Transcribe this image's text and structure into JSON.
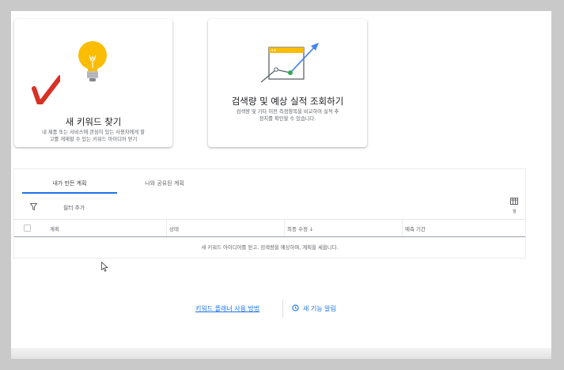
{
  "cards": [
    {
      "title": "새 키워드 찾기",
      "description_line1": "내 제품 또는 서비스에 관심이 있는 사용자에게 할",
      "description_line2": "고를 게재할 수 있는 키워드 아이디어 얻기",
      "icon": "lightbulb-icon"
    },
    {
      "title": "검색량 및 예상 실적 조회하기",
      "description_line1": "검색량 및 기타 이전 측정항목을 비교하여 실적 추",
      "description_line2": "정치를 확인할 수 있습니다.",
      "icon": "trend-chart-icon"
    }
  ],
  "plans": {
    "tabs": [
      {
        "label": "내가 만든 계획",
        "selected": true
      },
      {
        "label": "나와 공유된 계획",
        "selected": false
      }
    ],
    "filter_label": "필터 추가",
    "columns_icon_sub": "열",
    "columns": [
      "계획",
      "상태",
      "최종 수정 ↓",
      "예측 기간"
    ],
    "empty_message": "새 키워드 아이디어를 얻고, 검색량을 예상하며, 계획을 세웁니다."
  },
  "footer": {
    "help_link": "키워드 플래너 사용 방법",
    "whats_new": "새 기능 알림"
  },
  "colors": {
    "accent": "#1a73e8",
    "bulb": "#fbbc04",
    "checkmark": "#d93025"
  }
}
